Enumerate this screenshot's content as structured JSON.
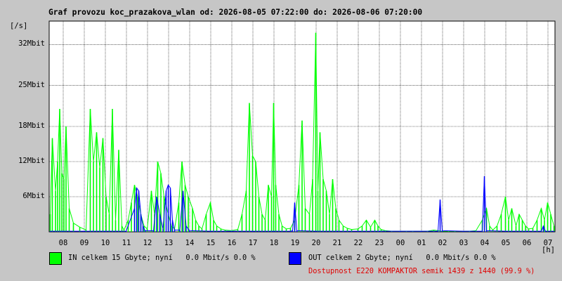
{
  "chart_data": {
    "type": "area",
    "title": "Graf provozu koc_prazakova_wlan od: 2026-08-05 07:22:00 do: 2026-08-06 07:20:00",
    "ylabel": "[/s]",
    "xlabel": "[h]",
    "y_unit": "Mbit",
    "ylim": [
      0,
      36
    ],
    "y_ticks": [
      {
        "value": 6,
        "label": "6Mbit"
      },
      {
        "value": 12,
        "label": "12Mbit"
      },
      {
        "value": 18,
        "label": "18Mbit"
      },
      {
        "value": 25,
        "label": "25Mbit"
      },
      {
        "value": 32,
        "label": "32Mbit"
      }
    ],
    "x_ticks": [
      "08",
      "09",
      "10",
      "11",
      "12",
      "13",
      "14",
      "15",
      "16",
      "17",
      "18",
      "19",
      "20",
      "21",
      "22",
      "23",
      "00",
      "01",
      "02",
      "03",
      "04",
      "05",
      "06",
      "07"
    ],
    "grid": true,
    "series": [
      {
        "name": "IN",
        "color": "#00ff00",
        "style": "filled",
        "points": [
          [
            7.4,
            3
          ],
          [
            7.5,
            16
          ],
          [
            7.65,
            7
          ],
          [
            7.75,
            12
          ],
          [
            7.85,
            21
          ],
          [
            7.95,
            10
          ],
          [
            8.05,
            9
          ],
          [
            8.15,
            18
          ],
          [
            8.3,
            4
          ],
          [
            8.5,
            1.5
          ],
          [
            8.8,
            0.8
          ],
          [
            9.1,
            0.3
          ],
          [
            9.3,
            21
          ],
          [
            9.45,
            12
          ],
          [
            9.6,
            17
          ],
          [
            9.75,
            11
          ],
          [
            9.9,
            16
          ],
          [
            10.05,
            6
          ],
          [
            10.2,
            3
          ],
          [
            10.35,
            21
          ],
          [
            10.5,
            2
          ],
          [
            10.65,
            14
          ],
          [
            10.8,
            1
          ],
          [
            10.9,
            0.3
          ],
          [
            11.1,
            2
          ],
          [
            11.25,
            5
          ],
          [
            11.4,
            8
          ],
          [
            11.55,
            6
          ],
          [
            11.7,
            3
          ],
          [
            11.85,
            1
          ],
          [
            12.0,
            0.5
          ],
          [
            12.2,
            7
          ],
          [
            12.35,
            3
          ],
          [
            12.5,
            12
          ],
          [
            12.65,
            10
          ],
          [
            12.8,
            6
          ],
          [
            13.0,
            3
          ],
          [
            13.15,
            1
          ],
          [
            13.3,
            0.5
          ],
          [
            13.5,
            5
          ],
          [
            13.65,
            12
          ],
          [
            13.8,
            8
          ],
          [
            13.95,
            6
          ],
          [
            14.15,
            4
          ],
          [
            14.3,
            2
          ],
          [
            14.45,
            1
          ],
          [
            14.6,
            0.5
          ],
          [
            14.8,
            3
          ],
          [
            15.0,
            5
          ],
          [
            15.15,
            2
          ],
          [
            15.3,
            1
          ],
          [
            15.5,
            0.5
          ],
          [
            15.7,
            0.3
          ],
          [
            16.0,
            0.2
          ],
          [
            16.3,
            0.4
          ],
          [
            16.5,
            3
          ],
          [
            16.7,
            7
          ],
          [
            16.85,
            22
          ],
          [
            17.0,
            13
          ],
          [
            17.15,
            12
          ],
          [
            17.3,
            6
          ],
          [
            17.45,
            3
          ],
          [
            17.6,
            2
          ],
          [
            17.75,
            8
          ],
          [
            17.9,
            6
          ],
          [
            18.0,
            22
          ],
          [
            18.1,
            8
          ],
          [
            18.25,
            3
          ],
          [
            18.4,
            1
          ],
          [
            18.6,
            0.5
          ],
          [
            18.8,
            0.6
          ],
          [
            19.0,
            2
          ],
          [
            19.2,
            8
          ],
          [
            19.35,
            19
          ],
          [
            19.5,
            4
          ],
          [
            19.7,
            3
          ],
          [
            19.85,
            9
          ],
          [
            20.0,
            34
          ],
          [
            20.1,
            7
          ],
          [
            20.2,
            17
          ],
          [
            20.35,
            9
          ],
          [
            20.5,
            7
          ],
          [
            20.65,
            3
          ],
          [
            20.8,
            9
          ],
          [
            20.95,
            4
          ],
          [
            21.1,
            2
          ],
          [
            21.3,
            1
          ],
          [
            21.5,
            0.6
          ],
          [
            21.7,
            0.4
          ],
          [
            22.0,
            0.5
          ],
          [
            22.2,
            1
          ],
          [
            22.4,
            2
          ],
          [
            22.6,
            0.8
          ],
          [
            22.8,
            2
          ],
          [
            22.95,
            1
          ],
          [
            23.1,
            0.4
          ],
          [
            23.3,
            0.2
          ],
          [
            23.6,
            0.1
          ],
          [
            24.0,
            0.1
          ],
          [
            24.3,
            0.1
          ],
          [
            24.6,
            0.1
          ],
          [
            25.0,
            0.1
          ],
          [
            25.3,
            0.1
          ],
          [
            25.6,
            0.3
          ],
          [
            25.8,
            0.2
          ],
          [
            26.0,
            0.1
          ],
          [
            26.3,
            0.1
          ],
          [
            26.6,
            0.1
          ],
          [
            27.0,
            0.1
          ],
          [
            27.3,
            0.1
          ],
          [
            27.6,
            0.2
          ],
          [
            27.9,
            2
          ],
          [
            28.1,
            4
          ],
          [
            28.25,
            1
          ],
          [
            28.4,
            0.3
          ],
          [
            28.6,
            1
          ],
          [
            28.8,
            3
          ],
          [
            29.0,
            6
          ],
          [
            29.15,
            2
          ],
          [
            29.3,
            4
          ],
          [
            29.5,
            1
          ],
          [
            29.65,
            3
          ],
          [
            29.8,
            2
          ],
          [
            29.95,
            1
          ],
          [
            30.1,
            0.5
          ],
          [
            30.3,
            0.6
          ],
          [
            30.5,
            2
          ],
          [
            30.7,
            4
          ],
          [
            30.85,
            2
          ],
          [
            31.0,
            5
          ],
          [
            31.15,
            3
          ],
          [
            31.3,
            1
          ]
        ]
      },
      {
        "name": "OUT",
        "color": "#0000ff",
        "style": "line",
        "points": [
          [
            7.4,
            0.1
          ],
          [
            8.0,
            0.1
          ],
          [
            9.0,
            0.1
          ],
          [
            10.0,
            0.1
          ],
          [
            11.0,
            0.1
          ],
          [
            11.4,
            4
          ],
          [
            11.5,
            7.5
          ],
          [
            11.6,
            7
          ],
          [
            11.7,
            3
          ],
          [
            11.8,
            1
          ],
          [
            11.9,
            0.2
          ],
          [
            12.3,
            0.2
          ],
          [
            12.45,
            6
          ],
          [
            12.6,
            3
          ],
          [
            12.75,
            0.5
          ],
          [
            12.9,
            7
          ],
          [
            13.0,
            8
          ],
          [
            13.1,
            7.5
          ],
          [
            13.2,
            2
          ],
          [
            13.3,
            0.3
          ],
          [
            13.55,
            0.3
          ],
          [
            13.7,
            7
          ],
          [
            13.85,
            1
          ],
          [
            14.0,
            0.2
          ],
          [
            15.0,
            0.1
          ],
          [
            16.0,
            0.1
          ],
          [
            17.0,
            0.1
          ],
          [
            18.0,
            0.1
          ],
          [
            18.8,
            0.1
          ],
          [
            18.9,
            0.2
          ],
          [
            19.0,
            5
          ],
          [
            19.1,
            0.2
          ],
          [
            20.0,
            0.1
          ],
          [
            21.0,
            0.1
          ],
          [
            22.0,
            0.1
          ],
          [
            23.0,
            0.1
          ],
          [
            24.0,
            0.1
          ],
          [
            25.0,
            0.1
          ],
          [
            25.8,
            0.1
          ],
          [
            25.9,
            5.5
          ],
          [
            26.0,
            0.2
          ],
          [
            27.0,
            0.1
          ],
          [
            27.9,
            0.1
          ],
          [
            28.0,
            9.5
          ],
          [
            28.1,
            0.2
          ],
          [
            29.0,
            0.1
          ],
          [
            30.0,
            0.1
          ],
          [
            30.7,
            0.1
          ],
          [
            30.8,
            1
          ],
          [
            30.9,
            0.1
          ],
          [
            31.3,
            0.1
          ]
        ]
      }
    ]
  },
  "legend": {
    "in": {
      "color": "#00ff00",
      "text": "IN celkem 15 Gbyte; nyní   0.0 Mbit/s 0.0 %"
    },
    "out": {
      "color": "#0000ff",
      "text": "OUT celkem 2 Gbyte; nyní   0.0 Mbit/s 0.0 %"
    },
    "availability": {
      "color": "#e00000",
      "text": "Dostupnost E220 KOMPAKTOR semik 1439 z 1440 (99.9 %)"
    }
  }
}
